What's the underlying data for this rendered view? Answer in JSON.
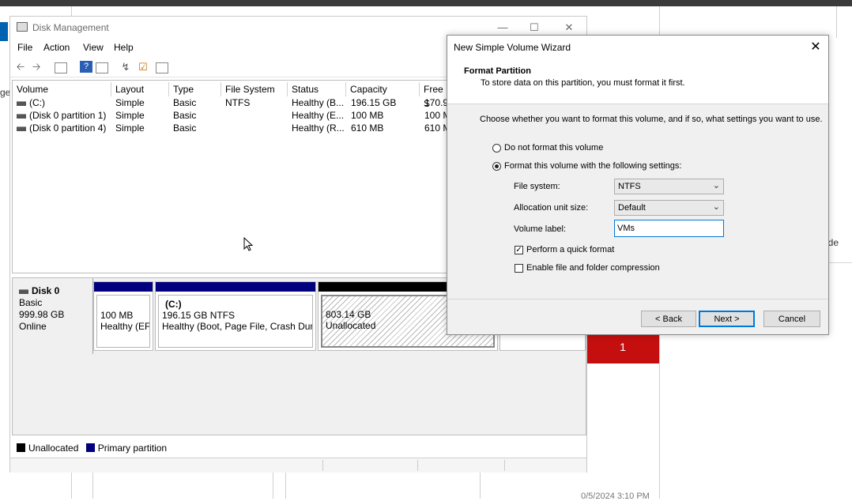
{
  "background": {
    "left_fragment": "ge",
    "right_fragment": "ide",
    "red_cell_value": "1",
    "date_fragment": "0/5/2024 3:10 PM"
  },
  "disk_management": {
    "title": "Disk Management",
    "menu": [
      "File",
      "Action",
      "View",
      "Help"
    ],
    "columns": [
      "Volume",
      "Layout",
      "Type",
      "File System",
      "Status",
      "Capacity",
      "Free S"
    ],
    "rows": [
      {
        "volume": "(C:)",
        "layout": "Simple",
        "type": "Basic",
        "fs": "NTFS",
        "status": "Healthy (B...",
        "capacity": "196.15 GB",
        "free": "170.9"
      },
      {
        "volume": "(Disk 0 partition 1)",
        "layout": "Simple",
        "type": "Basic",
        "fs": "",
        "status": "Healthy (E...",
        "capacity": "100 MB",
        "free": "100 M"
      },
      {
        "volume": "(Disk 0 partition 4)",
        "layout": "Simple",
        "type": "Basic",
        "fs": "",
        "status": "Healthy (R...",
        "capacity": "610 MB",
        "free": "610 M"
      }
    ],
    "disk": {
      "name": "Disk 0",
      "type": "Basic",
      "size": "999.98 GB",
      "state": "Online",
      "partitions": [
        {
          "line1": "",
          "line2": "100 MB",
          "line3": "Healthy (EFI"
        },
        {
          "line1": "(C:)",
          "line2": "196.15 GB NTFS",
          "line3": "Healthy (Boot, Page File, Crash Dump"
        },
        {
          "line1": "",
          "line2": "803.14 GB",
          "line3": "Unallocated"
        }
      ]
    },
    "legend": {
      "unallocated": "Unallocated",
      "primary": "Primary partition"
    },
    "colors": {
      "primary": "#00007f",
      "unallocated": "#000000"
    }
  },
  "wizard": {
    "title": "New Simple Volume Wizard",
    "close": "✕",
    "header_title": "Format Partition",
    "header_subtitle": "To store data on this partition, you must format it first.",
    "instruction": "Choose whether you want to format this volume, and if so, what settings you want to use.",
    "option_no_format": "Do not format this volume",
    "option_format": "Format this volume with the following settings:",
    "fs_label": "File system:",
    "fs_value": "NTFS",
    "alloc_label": "Allocation unit size:",
    "alloc_value": "Default",
    "vol_label": "Volume label:",
    "vol_value": "VMs",
    "quick_format": "Perform a quick format",
    "compression": "Enable file and folder compression",
    "back": "< Back",
    "next": "Next >",
    "cancel": "Cancel"
  }
}
